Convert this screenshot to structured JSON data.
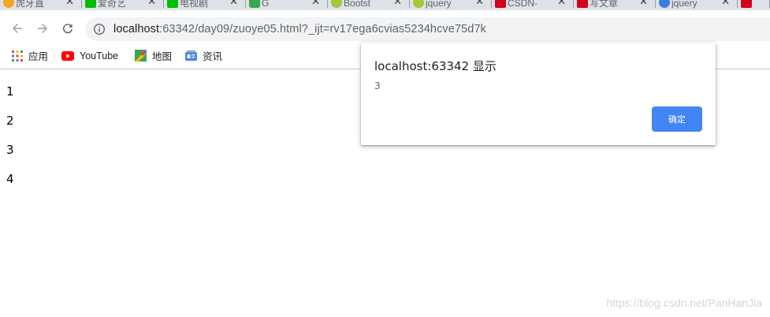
{
  "browser": {
    "tabs": [
      {
        "title": "虎牙直",
        "icon": "huya-icon",
        "color": "#f5a623"
      },
      {
        "title": "爱奇艺",
        "icon": "iqiyi-icon",
        "color": "#00be06"
      },
      {
        "title": "电视剧",
        "icon": "iqiyi-icon",
        "color": "#00be06"
      },
      {
        "title": "G",
        "icon": "play-icon",
        "color": "#34a853"
      },
      {
        "title": "Bootst",
        "icon": "android-icon",
        "color": "#a4c639"
      },
      {
        "title": "jquery",
        "icon": "android-icon",
        "color": "#a4c639"
      },
      {
        "title": "CSDN-",
        "icon": "csdn-icon",
        "color": "#d0021b"
      },
      {
        "title": "写文章",
        "icon": "csdn-icon",
        "color": "#d0021b"
      },
      {
        "title": "jquery",
        "icon": "paw-icon",
        "color": "#3b7ddd"
      }
    ],
    "tab_close_glyph": "✕",
    "address": {
      "host": "localhost",
      "path": ":63342/day09/zuoye05.html?_ijt=rv17ega6cvias5234hcve75d7k"
    },
    "bookmarks": [
      {
        "label": "应用",
        "icon": "apps-grid-icon"
      },
      {
        "label": "YouTube",
        "icon": "youtube-icon"
      },
      {
        "label": "地图",
        "icon": "maps-icon"
      },
      {
        "label": "资讯",
        "icon": "news-icon"
      }
    ]
  },
  "page": {
    "items": [
      "1",
      "2",
      "3",
      "4"
    ],
    "watermark": "https://blog.csdn.net/PanHanJia"
  },
  "dialog": {
    "title": "localhost:63342 显示",
    "message": "3",
    "ok_label": "确定",
    "ok_color": "#4285f4"
  }
}
